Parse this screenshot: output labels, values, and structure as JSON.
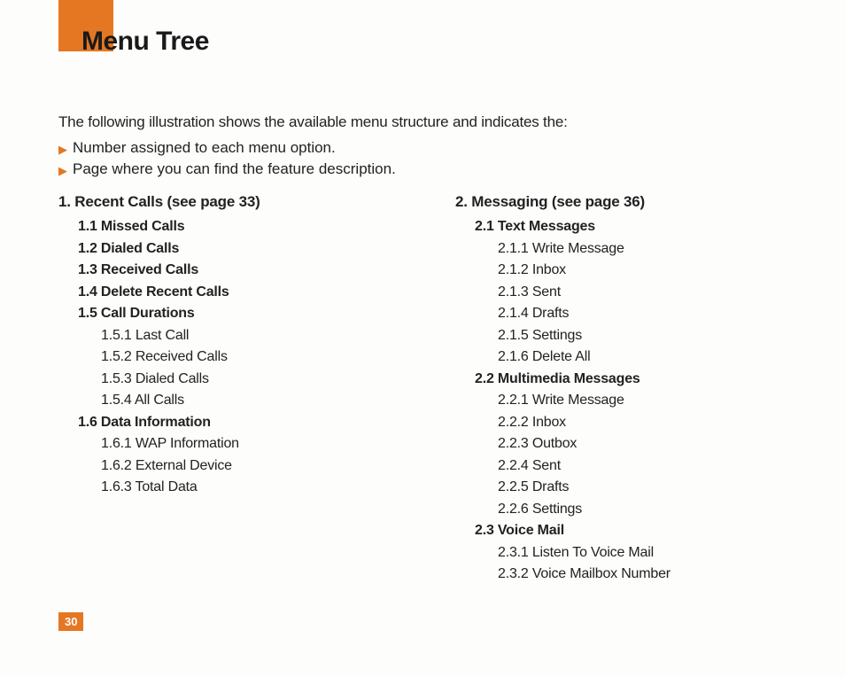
{
  "pageTitle": "Menu Tree",
  "intro": "The following illustration shows the available menu structure and indicates the:",
  "bullets": [
    "Number assigned to each menu option.",
    "Page where you can find the feature description."
  ],
  "leftColumn": {
    "heading": "1.  Recent Calls (see page 33)",
    "items": [
      {
        "level": 2,
        "text": "1.1 Missed Calls"
      },
      {
        "level": 2,
        "text": "1.2 Dialed Calls"
      },
      {
        "level": 2,
        "text": "1.3 Received Calls"
      },
      {
        "level": 2,
        "text": "1.4 Delete Recent Calls"
      },
      {
        "level": 2,
        "text": "1.5 Call Durations"
      },
      {
        "level": 3,
        "text": "1.5.1 Last Call"
      },
      {
        "level": 3,
        "text": "1.5.2 Received Calls"
      },
      {
        "level": 3,
        "text": "1.5.3 Dialed Calls"
      },
      {
        "level": 3,
        "text": "1.5.4 All Calls"
      },
      {
        "level": 2,
        "text": "1.6 Data Information"
      },
      {
        "level": 3,
        "text": "1.6.1 WAP Information"
      },
      {
        "level": 3,
        "text": "1.6.2 External Device"
      },
      {
        "level": 3,
        "text": "1.6.3 Total Data"
      }
    ]
  },
  "rightColumn": {
    "heading": "2.  Messaging (see page 36)",
    "items": [
      {
        "level": 2,
        "text": "2.1 Text Messages"
      },
      {
        "level": 3,
        "text": "2.1.1 Write Message"
      },
      {
        "level": 3,
        "text": "2.1.2 Inbox"
      },
      {
        "level": 3,
        "text": "2.1.3 Sent"
      },
      {
        "level": 3,
        "text": "2.1.4 Drafts"
      },
      {
        "level": 3,
        "text": "2.1.5 Settings"
      },
      {
        "level": 3,
        "text": "2.1.6 Delete All"
      },
      {
        "level": 2,
        "text": "2.2 Multimedia Messages"
      },
      {
        "level": 3,
        "text": "2.2.1 Write Message"
      },
      {
        "level": 3,
        "text": "2.2.2 Inbox"
      },
      {
        "level": 3,
        "text": "2.2.3 Outbox"
      },
      {
        "level": 3,
        "text": "2.2.4 Sent"
      },
      {
        "level": 3,
        "text": "2.2.5 Drafts"
      },
      {
        "level": 3,
        "text": "2.2.6 Settings"
      },
      {
        "level": 2,
        "text": "2.3 Voice Mail"
      },
      {
        "level": 3,
        "text": "2.3.1 Listen To Voice Mail"
      },
      {
        "level": 3,
        "text": "2.3.2 Voice Mailbox Number"
      }
    ]
  },
  "pageNumber": "30"
}
